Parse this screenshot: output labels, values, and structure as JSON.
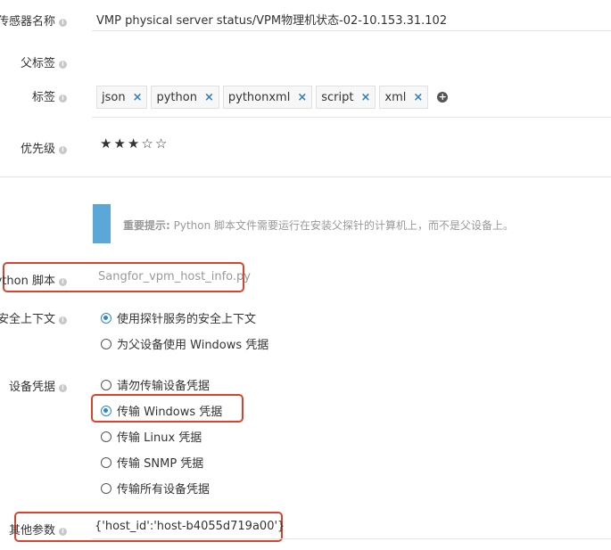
{
  "sensor_name": {
    "label": "传感器名称",
    "value": "VMP physical server status/VPM物理机状态-02-10.153.31.102"
  },
  "parent_tags": {
    "label": "父标签",
    "value": ""
  },
  "tags": {
    "label": "标签",
    "items": [
      "json",
      "python",
      "pythonxml",
      "script",
      "xml"
    ],
    "remove_glyph": "×",
    "add_glyph": "+"
  },
  "priority": {
    "label": "优先级",
    "stars_filled": 3,
    "stars_total": 5,
    "filled_glyph": "★",
    "empty_glyph": "☆"
  },
  "notice": {
    "title": "重要提示:",
    "text": " Python 脚本文件需要运行在安装父探针的计算机上，而不是父设备上。"
  },
  "python_script": {
    "label": "Python 脚本",
    "value": "Sangfor_vpm_host_info.py"
  },
  "security_context": {
    "label": "安全上下文",
    "options": [
      "使用探针服务的安全上下文",
      "为父设备使用 Windows 凭据"
    ],
    "selected": 0
  },
  "device_credentials": {
    "label": "设备凭据",
    "options": [
      "请勿传输设备凭据",
      "传输 Windows 凭据",
      "传输 Linux 凭据",
      "传输 SNMP 凭据",
      "传输所有设备凭据"
    ],
    "selected": 1
  },
  "other_params": {
    "label": "其他参数",
    "value": "{'host_id':'host-b4055d719a00'}"
  },
  "info_glyph": "i",
  "colors": {
    "accent": "#2f87c8",
    "highlight": "#d9432d",
    "notice_bar": "#5ba7d8"
  }
}
